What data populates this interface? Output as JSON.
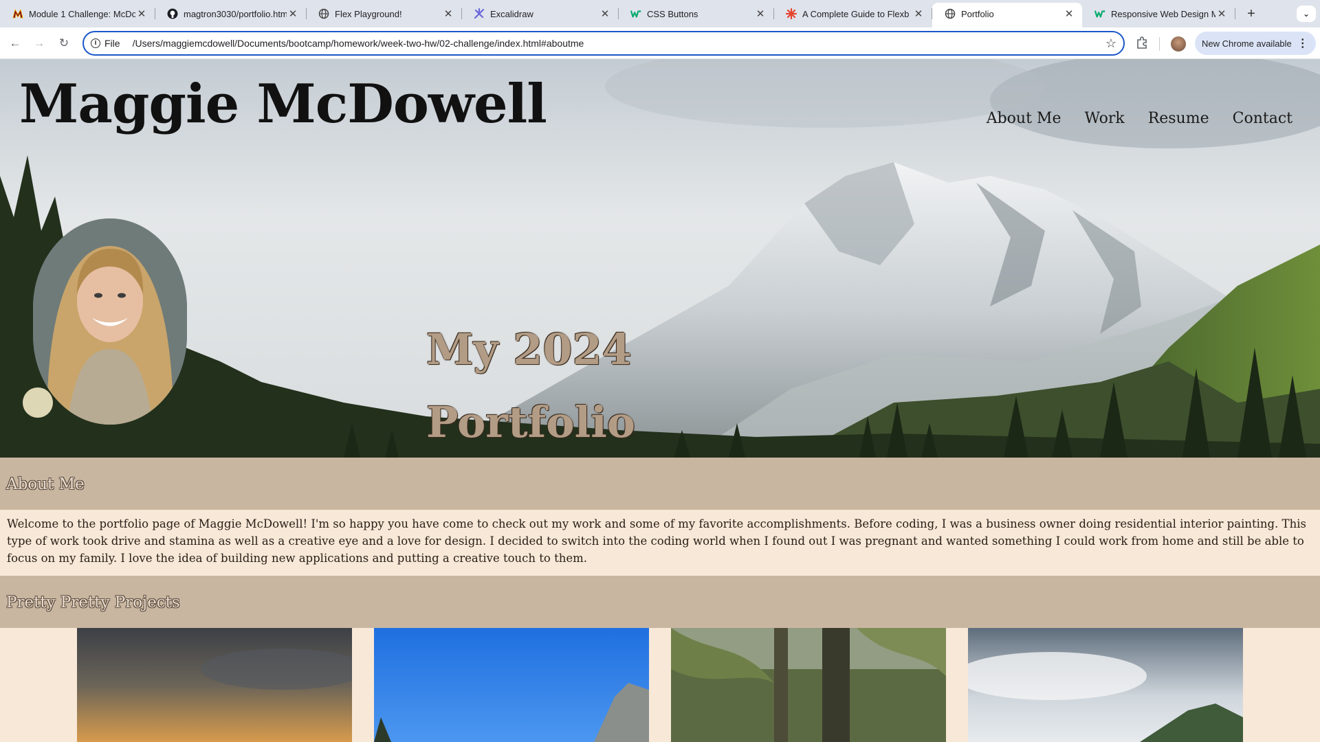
{
  "browser": {
    "tabs": [
      {
        "title": "Module 1 Challenge: McDo",
        "icon": "m-logo-icon"
      },
      {
        "title": "magtron3030/portfolio.htm",
        "icon": "github-icon"
      },
      {
        "title": "Flex Playground!",
        "icon": "globe-icon"
      },
      {
        "title": "Excalidraw",
        "icon": "excalidraw-icon"
      },
      {
        "title": "CSS Buttons",
        "icon": "w3schools-icon"
      },
      {
        "title": "A Complete Guide to Flexb",
        "icon": "css-tricks-icon"
      },
      {
        "title": "Portfolio",
        "icon": "globe-icon",
        "active": true
      },
      {
        "title": "Responsive Web Design M",
        "icon": "w3schools-icon"
      }
    ],
    "address": {
      "scheme_label": "File",
      "url": "/Users/maggiemcdowell/Documents/bootcamp/homework/week-two-hw/02-challenge/index.html#aboutme"
    },
    "update_label": "New Chrome available"
  },
  "site": {
    "title": "Maggie McDowell",
    "nav": [
      "About Me",
      "Work",
      "Resume",
      "Contact"
    ],
    "hero_heading": "My 2024 Portfolio",
    "about": {
      "heading": "About Me",
      "text": "Welcome to the portfolio page of Maggie McDowell! I'm so happy you have come to check out my work and some of my favorite accomplishments. Before coding, I was a business owner doing residential interior painting. This type of work took drive and stamina as well as a creative eye and a love for design. I decided to switch into the coding world when I found out I was pregnant and wanted something I could work from home and still be able to focus on my family. I love the idea of building new applications and putting a creative touch to them."
    },
    "projects": {
      "heading": "Pretty Pretty Projects",
      "items": [
        "sunset-photo",
        "mountain-blue-sky-photo",
        "mossy-forest-photo",
        "cloudy-mountain-photo"
      ]
    }
  },
  "colors": {
    "section_header_bg": "#c9b6a1",
    "section_body_bg": "#f8e8d8",
    "omnibox_border": "#1a56c7"
  }
}
